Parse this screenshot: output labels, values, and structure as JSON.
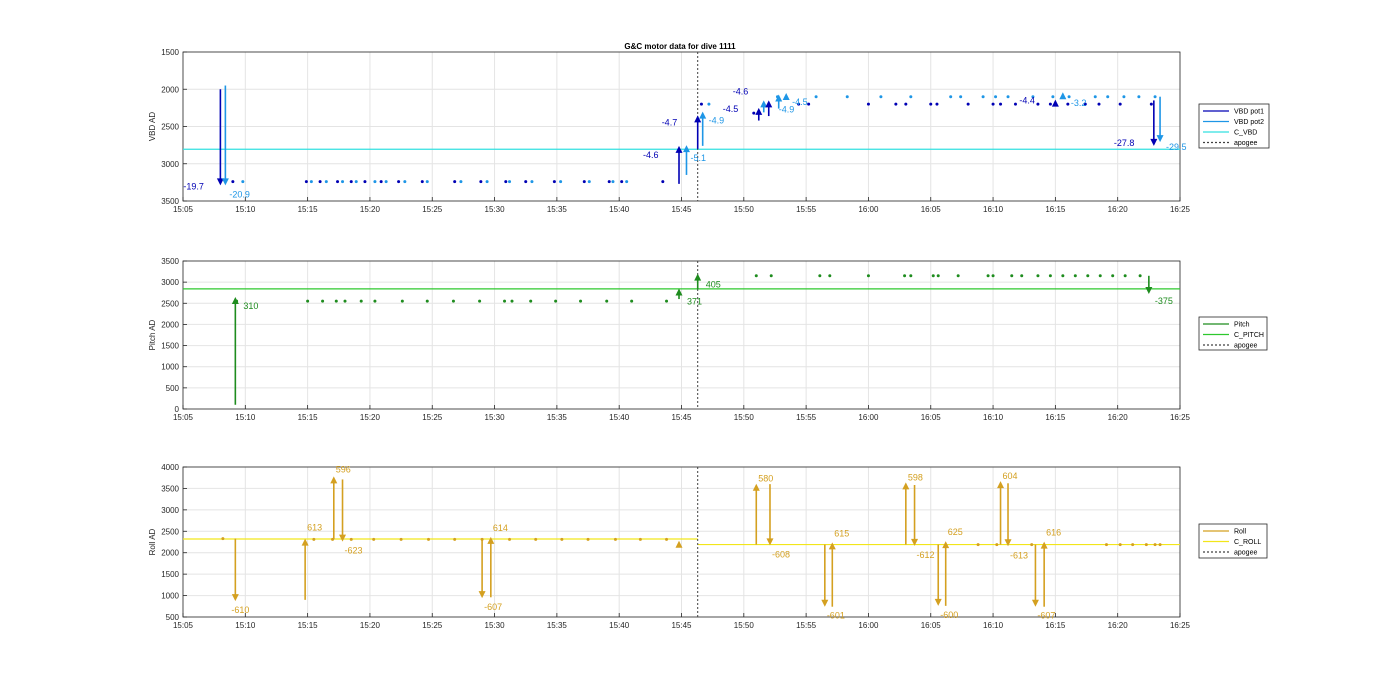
{
  "title": "G&C motor data for dive 1111",
  "x_tick_labels": [
    "15:05",
    "15:10",
    "15:15",
    "15:20",
    "15:25",
    "15:30",
    "15:35",
    "15:40",
    "15:45",
    "15:50",
    "15:55",
    "16:00",
    "16:05",
    "16:10",
    "16:15",
    "16:20",
    "16:25"
  ],
  "chart_data": [
    {
      "type": "scatter",
      "ylabel": "VBD AD",
      "ylim": [
        1500,
        3500
      ],
      "y_reversed": true,
      "yticks": [
        1500,
        2000,
        2500,
        3000,
        3500
      ],
      "xlim_minutes_after_15_05": [
        0,
        80
      ],
      "grid": true,
      "legend_position": "right",
      "legend": [
        "VBD pot1",
        "VBD pot2",
        "C_VBD",
        "apogee"
      ],
      "colors": {
        "pot1": "#0000b4",
        "pot2": "#1e96e6",
        "target": "#33e0e0",
        "apogee": "#404040"
      },
      "target_value": 2805,
      "apogee_minute": 41.3,
      "pot1_points": [
        [
          4,
          3240
        ],
        [
          9.9,
          3240
        ],
        [
          11,
          3240
        ],
        [
          12.4,
          3240
        ],
        [
          13.5,
          3240
        ],
        [
          14.6,
          3240
        ],
        [
          15.9,
          3240
        ],
        [
          17.3,
          3240
        ],
        [
          19.2,
          3240
        ],
        [
          21.8,
          3240
        ],
        [
          23.9,
          3240
        ],
        [
          25.9,
          3240
        ],
        [
          27.5,
          3240
        ],
        [
          29.8,
          3240
        ],
        [
          32.2,
          3240
        ],
        [
          34.2,
          3240
        ],
        [
          35.2,
          3240
        ],
        [
          38.5,
          3240
        ],
        [
          41.6,
          2200
        ],
        [
          45.8,
          2320
        ],
        [
          46.6,
          2200
        ],
        [
          49.4,
          2200
        ],
        [
          50.2,
          2200
        ],
        [
          55,
          2200
        ],
        [
          57.2,
          2200
        ],
        [
          58,
          2200
        ],
        [
          60,
          2200
        ],
        [
          60.5,
          2200
        ],
        [
          63,
          2200
        ],
        [
          65,
          2200
        ],
        [
          65.6,
          2200
        ],
        [
          66.8,
          2200
        ],
        [
          68.6,
          2200
        ],
        [
          69.6,
          2200
        ],
        [
          71,
          2200
        ],
        [
          72.4,
          2200
        ],
        [
          73.5,
          2200
        ],
        [
          75.2,
          2200
        ],
        [
          77.7,
          2200
        ]
      ],
      "pot2_points": [
        [
          4.8,
          3240
        ],
        [
          10.3,
          3240
        ],
        [
          11.5,
          3240
        ],
        [
          12.8,
          3240
        ],
        [
          13.9,
          3240
        ],
        [
          15.4,
          3240
        ],
        [
          16.3,
          3240
        ],
        [
          17.8,
          3240
        ],
        [
          19.6,
          3240
        ],
        [
          22.3,
          3240
        ],
        [
          24.4,
          3240
        ],
        [
          26.2,
          3240
        ],
        [
          28,
          3240
        ],
        [
          30.3,
          3240
        ],
        [
          32.6,
          3240
        ],
        [
          34.5,
          3240
        ],
        [
          35.6,
          3240
        ],
        [
          42.2,
          2200
        ],
        [
          47.7,
          2100
        ],
        [
          50.8,
          2100
        ],
        [
          53.3,
          2100
        ],
        [
          56,
          2100
        ],
        [
          58.4,
          2100
        ],
        [
          61.6,
          2100
        ],
        [
          62.4,
          2100
        ],
        [
          64.2,
          2100
        ],
        [
          65.2,
          2100
        ],
        [
          66.2,
          2100
        ],
        [
          68.2,
          2100
        ],
        [
          69.8,
          2100
        ],
        [
          71.1,
          2100
        ],
        [
          73.2,
          2100
        ],
        [
          74.2,
          2100
        ],
        [
          75.5,
          2100
        ],
        [
          76.7,
          2100
        ],
        [
          78,
          2100
        ]
      ],
      "arrows": [
        {
          "series": "pot1",
          "x": 3.0,
          "y_from": 2000,
          "y_to": 3290,
          "label": "-19.7",
          "label_dx": -37,
          "label_dy": 4
        },
        {
          "series": "pot2",
          "x": 3.4,
          "y_from": 1950,
          "y_to": 3290,
          "label": "-20.9",
          "label_dx": 4,
          "label_dy": 12
        },
        {
          "series": "pot1",
          "x": 39.8,
          "y_from": 3270,
          "y_to": 2760,
          "label": "-4.6",
          "label_dx": -36,
          "label_dy": 12
        },
        {
          "series": "pot2",
          "x": 40.4,
          "y_from": 3150,
          "y_to": 2750,
          "label": "-5.1",
          "label_dx": 4,
          "label_dy": 16
        },
        {
          "series": "pot1",
          "x": 41.3,
          "y_from": 2800,
          "y_to": 2350,
          "label": "-4.7",
          "label_dx": -36,
          "label_dy": 10
        },
        {
          "series": "pot2",
          "x": 41.7,
          "y_from": 2760,
          "y_to": 2300,
          "label": "-4.9",
          "label_dx": 6,
          "label_dy": 12
        },
        {
          "series": "pot1",
          "x": 46.2,
          "y_from": 2420,
          "y_to": 2250,
          "label": "-4.5",
          "label_dx": -36,
          "label_dy": 4
        },
        {
          "series": "pot2",
          "x": 46.6,
          "y_from": 2310,
          "y_to": 2150,
          "label": "",
          "label_dx": 0,
          "label_dy": 0
        },
        {
          "series": "pot1",
          "x": 47.0,
          "y_from": 2360,
          "y_to": 2150,
          "label": "-4.6",
          "label_dx": -36,
          "label_dy": -6
        },
        {
          "series": "pot2",
          "x": 47.8,
          "y_from": 2260,
          "y_to": 2070,
          "label": "-4.9",
          "label_dx": 0,
          "label_dy": 18
        },
        {
          "series": "pot2",
          "x": 48.4,
          "y_from": 2140,
          "y_to": 2050,
          "label": "-4.5",
          "label_dx": 6,
          "label_dy": 12
        },
        {
          "series": "pot1",
          "x": 70.0,
          "y_from": 2210,
          "y_to": 2140,
          "label": "-4.4",
          "label_dx": -36,
          "label_dy": 4
        },
        {
          "series": "pot2",
          "x": 70.6,
          "y_from": 2120,
          "y_to": 2040,
          "label": "-3.2",
          "label_dx": 8,
          "label_dy": 14
        },
        {
          "series": "pot1",
          "x": 77.9,
          "y_from": 2150,
          "y_to": 2760,
          "label": "-27.8",
          "label_dx": -40,
          "label_dy": 0
        },
        {
          "series": "pot2",
          "x": 78.4,
          "y_from": 2100,
          "y_to": 2710,
          "label": "-29.5",
          "label_dx": 6,
          "label_dy": 8
        }
      ]
    },
    {
      "type": "scatter",
      "ylabel": "Pitch AD",
      "ylim": [
        0,
        3500
      ],
      "yticks": [
        0,
        500,
        1000,
        1500,
        2000,
        2500,
        3000,
        3500
      ],
      "xlim_minutes_after_15_05": [
        0,
        80
      ],
      "grid": true,
      "legend_position": "right",
      "legend": [
        "Pitch",
        "C_PITCH",
        "apogee"
      ],
      "colors": {
        "pitch": "#1e8c1e",
        "target": "#2ec82e",
        "apogee": "#404040"
      },
      "target_value": 2840,
      "apogee_minute": 41.3,
      "points": [
        [
          4.3,
          2550
        ],
        [
          10,
          2550
        ],
        [
          11.2,
          2550
        ],
        [
          12.3,
          2550
        ],
        [
          13,
          2550
        ],
        [
          14.3,
          2550
        ],
        [
          15.4,
          2550
        ],
        [
          17.6,
          2550
        ],
        [
          19.6,
          2550
        ],
        [
          21.7,
          2550
        ],
        [
          23.8,
          2550
        ],
        [
          25.8,
          2550
        ],
        [
          26.4,
          2550
        ],
        [
          27.9,
          2550
        ],
        [
          29.9,
          2550
        ],
        [
          31.9,
          2550
        ],
        [
          34,
          2550
        ],
        [
          36,
          2550
        ],
        [
          38.8,
          2550
        ],
        [
          46,
          3150
        ],
        [
          47.2,
          3150
        ],
        [
          51.1,
          3150
        ],
        [
          51.9,
          3150
        ],
        [
          55,
          3150
        ],
        [
          57.9,
          3150
        ],
        [
          58.4,
          3150
        ],
        [
          60.2,
          3150
        ],
        [
          60.6,
          3150
        ],
        [
          62.2,
          3150
        ],
        [
          64.6,
          3150
        ],
        [
          65,
          3150
        ],
        [
          66.5,
          3150
        ],
        [
          67.3,
          3150
        ],
        [
          68.6,
          3150
        ],
        [
          69.6,
          3150
        ],
        [
          70.6,
          3150
        ],
        [
          71.6,
          3150
        ],
        [
          72.6,
          3150
        ],
        [
          73.6,
          3150
        ],
        [
          74.6,
          3150
        ],
        [
          75.6,
          3150
        ],
        [
          76.8,
          3150
        ]
      ],
      "arrows": [
        {
          "x": 4.2,
          "y_from": 100,
          "y_to": 2650,
          "label": "310",
          "label_dx": 8,
          "label_dy": 12
        },
        {
          "x": 39.8,
          "y_from": 2600,
          "y_to": 2850,
          "label": "371",
          "label_dx": 8,
          "label_dy": 16
        },
        {
          "x": 41.3,
          "y_from": 2830,
          "y_to": 3200,
          "label": "405",
          "label_dx": 8,
          "label_dy": 14
        },
        {
          "x": 77.5,
          "y_from": 3150,
          "y_to": 2720,
          "label": "-375",
          "label_dx": 6,
          "label_dy": 10
        }
      ]
    },
    {
      "type": "scatter",
      "ylabel": "Roll AD",
      "ylim": [
        500,
        4000
      ],
      "yticks": [
        500,
        1000,
        1500,
        2000,
        2500,
        3000,
        3500,
        4000
      ],
      "xlim_minutes_after_15_05": [
        0,
        80
      ],
      "grid": true,
      "legend_position": "right",
      "legend": [
        "Roll",
        "C_ROLL",
        "apogee"
      ],
      "colors": {
        "roll": "#d4a020",
        "target": "#f2e61a",
        "apogee": "#404040"
      },
      "target_before": 2320,
      "target_after": 2190,
      "apogee_minute": 41.3,
      "points": [
        [
          3.2,
          2330
        ],
        [
          10.5,
          2310
        ],
        [
          12,
          2310
        ],
        [
          13.5,
          2310
        ],
        [
          15.3,
          2310
        ],
        [
          17.5,
          2310
        ],
        [
          19.7,
          2310
        ],
        [
          21.8,
          2310
        ],
        [
          24,
          2310
        ],
        [
          26.2,
          2310
        ],
        [
          28.3,
          2310
        ],
        [
          30.4,
          2310
        ],
        [
          32.5,
          2310
        ],
        [
          34.7,
          2310
        ],
        [
          36.7,
          2310
        ],
        [
          38.8,
          2310
        ],
        [
          63.8,
          2190
        ],
        [
          65.3,
          2190
        ],
        [
          68.1,
          2190
        ],
        [
          74.1,
          2190
        ],
        [
          75.2,
          2190
        ],
        [
          76.2,
          2190
        ],
        [
          77.3,
          2190
        ],
        [
          78,
          2190
        ],
        [
          78.4,
          2190
        ]
      ],
      "arrows": [
        {
          "x": 4.2,
          "y_from": 2330,
          "y_to": 870,
          "label": "-610",
          "label_dx": -4,
          "label_dy": 12
        },
        {
          "x": 9.8,
          "y_from": 900,
          "y_to": 2330,
          "label": "613",
          "label_dx": 2,
          "label_dy": -8
        },
        {
          "x": 12.1,
          "y_from": 2310,
          "y_to": 3780,
          "label": "596",
          "label_dx": 2,
          "label_dy": -4
        },
        {
          "x": 12.8,
          "y_from": 3710,
          "y_to": 2260,
          "label": "-623",
          "label_dx": 2,
          "label_dy": 12
        },
        {
          "x": 24.0,
          "y_from": 2330,
          "y_to": 940,
          "label": "-607",
          "label_dx": 2,
          "label_dy": 12
        },
        {
          "x": 24.7,
          "y_from": 960,
          "y_to": 2370,
          "label": "614",
          "label_dx": 2,
          "label_dy": -6
        },
        {
          "x": 39.8,
          "y_from": 2150,
          "y_to": 2280,
          "label": "",
          "label_dx": 0,
          "label_dy": 0
        },
        {
          "x": 46.0,
          "y_from": 2190,
          "y_to": 3610,
          "label": "580",
          "label_dx": 2,
          "label_dy": -2
        },
        {
          "x": 47.1,
          "y_from": 3600,
          "y_to": 2170,
          "label": "-608",
          "label_dx": 2,
          "label_dy": 12
        },
        {
          "x": 51.5,
          "y_from": 2190,
          "y_to": 740,
          "label": "-601",
          "label_dx": 2,
          "label_dy": 12
        },
        {
          "x": 52.1,
          "y_from": 740,
          "y_to": 2240,
          "label": "615",
          "label_dx": 2,
          "label_dy": -6
        },
        {
          "x": 58.0,
          "y_from": 2190,
          "y_to": 3640,
          "label": "598",
          "label_dx": 2,
          "label_dy": -2
        },
        {
          "x": 58.7,
          "y_from": 3580,
          "y_to": 2160,
          "label": "-612",
          "label_dx": 2,
          "label_dy": 12
        },
        {
          "x": 60.6,
          "y_from": 2190,
          "y_to": 760,
          "label": "-600",
          "label_dx": 2,
          "label_dy": 12
        },
        {
          "x": 61.2,
          "y_from": 760,
          "y_to": 2270,
          "label": "625",
          "label_dx": 2,
          "label_dy": -6
        },
        {
          "x": 65.6,
          "y_from": 2190,
          "y_to": 3670,
          "label": "604",
          "label_dx": 2,
          "label_dy": -2
        },
        {
          "x": 66.2,
          "y_from": 3620,
          "y_to": 2150,
          "label": "-613",
          "label_dx": 2,
          "label_dy": 12
        },
        {
          "x": 68.4,
          "y_from": 2190,
          "y_to": 740,
          "label": "-607",
          "label_dx": 2,
          "label_dy": 12
        },
        {
          "x": 69.1,
          "y_from": 740,
          "y_to": 2260,
          "label": "616",
          "label_dx": 2,
          "label_dy": -6
        }
      ]
    }
  ]
}
